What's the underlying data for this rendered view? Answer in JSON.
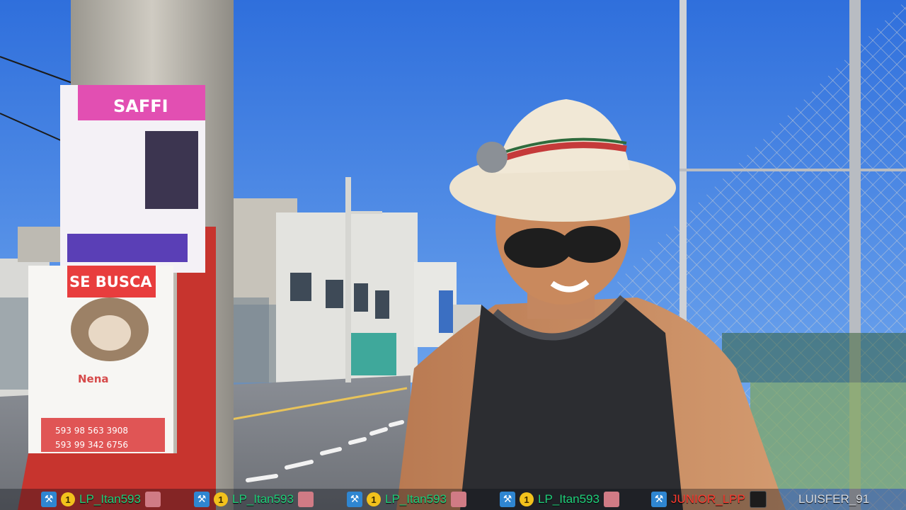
{
  "scene": {
    "poster_top_title": "SAFFI",
    "poster_lost_banner": "SE BUSCA",
    "poster_pet_name": "Nena",
    "poster_phone_1": "593 98 563 3908",
    "poster_phone_2": "593 99 342 6756"
  },
  "ticker": {
    "items": [
      {
        "name": "LP_Itan593",
        "badge": "⚒",
        "coin": "1"
      },
      {
        "name": "LP_Itan593",
        "badge": "⚒",
        "coin": "1"
      },
      {
        "name": "LP_Itan593",
        "badge": "⚒",
        "coin": "1"
      },
      {
        "name": "LP_Itan593",
        "badge": "⚒",
        "coin": "1"
      },
      {
        "name": "JUNIOR_LPP",
        "badge": "⚒"
      },
      {
        "name": "LUISFER_91"
      }
    ]
  }
}
